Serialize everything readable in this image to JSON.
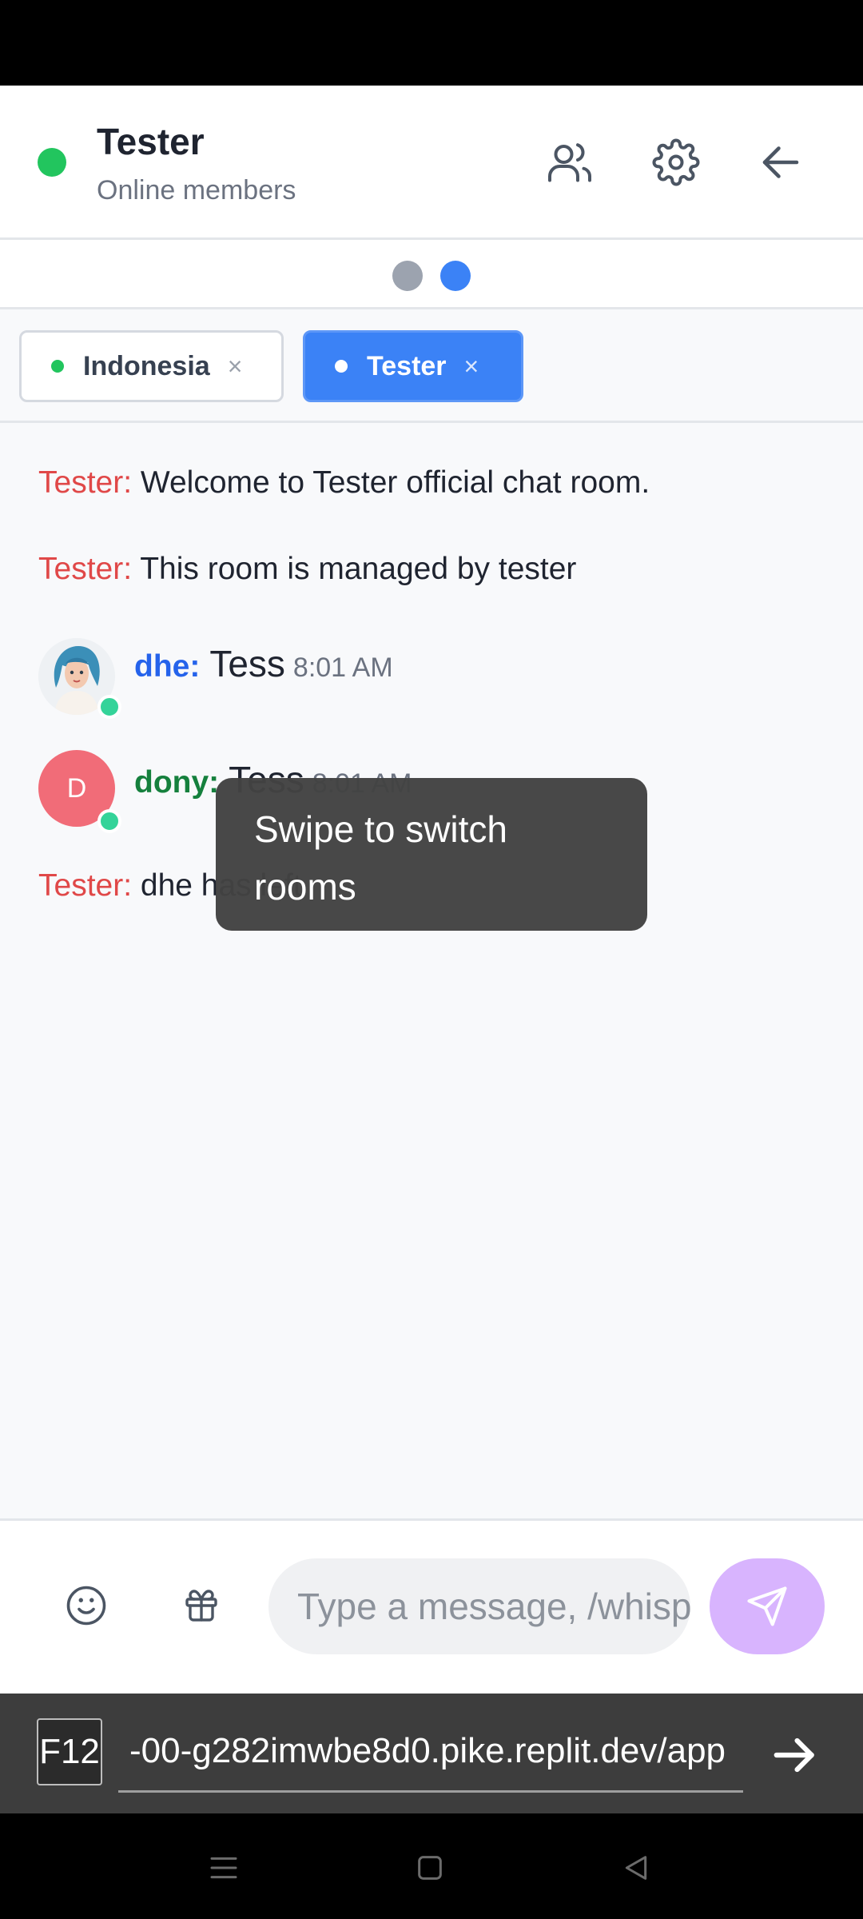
{
  "header": {
    "title": "Tester",
    "subtitle": "Online members",
    "status_color": "#22c55e",
    "icons": [
      "members-icon",
      "gear-icon",
      "back-arrow-icon"
    ]
  },
  "pager": {
    "count": 2,
    "active_index": 1
  },
  "tabs": [
    {
      "label": "Indonesia",
      "close": "×",
      "active": false,
      "dot_color": "#22c55e"
    },
    {
      "label": "Tester",
      "close": "×",
      "active": true,
      "dot_color": "#ffffff"
    }
  ],
  "messages": [
    {
      "type": "system",
      "author": "Tester:",
      "text": "Welcome to Tester official chat room."
    },
    {
      "type": "system",
      "author": "Tester:",
      "text": "This room is managed by tester"
    },
    {
      "type": "user",
      "author": "dhe:",
      "text": "Tess",
      "time": "8:01 AM",
      "name_color": "#2563eb",
      "avatar": "portrait-avatar"
    },
    {
      "type": "user",
      "author": "dony:",
      "text": "Tess",
      "time": "8:01 AM",
      "name_color": "#15803d",
      "avatar_initial": "D"
    },
    {
      "type": "system",
      "author": "Tester:",
      "text": "dhe has left"
    }
  ],
  "toast": {
    "text": "Swipe to switch rooms"
  },
  "composer": {
    "placeholder": "Type a message, /whisper",
    "icons": [
      "emoji-icon",
      "gift-icon",
      "send-icon"
    ],
    "send_color": "#d8b4fe"
  },
  "browser": {
    "f12_label": "F12",
    "url": "-00-g282imwbe8d0.pike.replit.dev/app"
  },
  "colors": {
    "system_author": "#e04848",
    "accent": "#3b82f6"
  }
}
